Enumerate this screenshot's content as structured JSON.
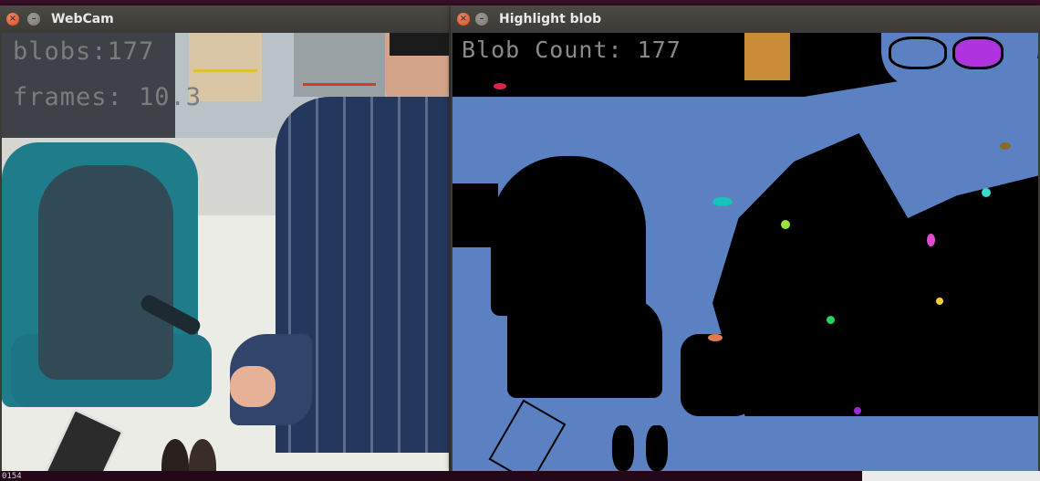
{
  "webcam_window": {
    "title": "WebCam",
    "overlay_lines": [
      "blobs:177",
      "frames: 10.3"
    ]
  },
  "blob_window": {
    "title": "Highlight blob",
    "overlay_text": "Blob Count: 177"
  },
  "terminal": {
    "text": "0154"
  },
  "titlebar_buttons": {
    "close_glyph": "×",
    "minimize_glyph": "–"
  },
  "colors": {
    "titlebar": "#3c3b37",
    "close_button": "#d8491d",
    "blob_background": "#5b81c3",
    "overlay_text": "#7c7c7c"
  },
  "icons": [
    "close-icon",
    "minimize-icon"
  ]
}
